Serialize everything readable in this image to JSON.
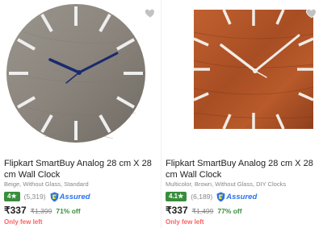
{
  "products": [
    {
      "title": "Flipkart SmartBuy Analog 28 cm X 28 cm Wall Clock",
      "subtitle": "Beige, Without Glass, Standard",
      "rating": "4★",
      "rating_count": "(5,319)",
      "assured_label": "Assured",
      "price": "₹337",
      "mrp": "₹1,399",
      "discount": "71% off",
      "stock": "Only few left",
      "icons": {
        "wishlist": "heart-icon",
        "assured": "flipkart-assured-badge-icon"
      },
      "colors": {
        "face": "#8c8780",
        "hands": "#1a2a6e",
        "markers": "#e8e8e8"
      }
    },
    {
      "title": "Flipkart SmartBuy Analog 28 cm X 28 cm Wall Clock",
      "subtitle": "Multicolor, Brown, Without Glass, DIY Clocks",
      "rating": "4.1★",
      "rating_count": "(6,189)",
      "assured_label": "Assured",
      "price": "₹337",
      "mrp": "₹1,499",
      "discount": "77% off",
      "stock": "Only few left",
      "icons": {
        "wishlist": "heart-icon",
        "assured": "flipkart-assured-badge-icon"
      },
      "colors": {
        "face": "#b5532a",
        "hands": "#f0ece6",
        "markers": "#f0ece6"
      }
    }
  ],
  "theme": {
    "rating_green": "#388e3c",
    "assured_blue": "#2874f0",
    "stock_red": "#ff6161"
  }
}
